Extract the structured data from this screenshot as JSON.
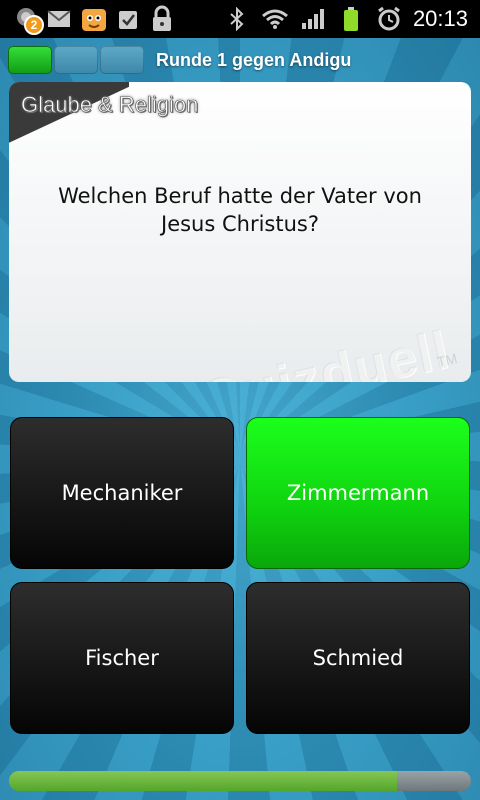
{
  "status_bar": {
    "notification_count": "2",
    "time": "20:13",
    "icons": [
      "notification-icon",
      "email-icon",
      "app-icon",
      "task-icon",
      "lock-icon",
      "bluetooth-icon",
      "wifi-icon",
      "signal-icon",
      "battery-icon",
      "alarm-icon"
    ]
  },
  "round": {
    "title": "Runde 1 gegen Andigu",
    "segments_done": 1,
    "segments_total": 3
  },
  "question": {
    "category": "Glaube & Religion",
    "text": "Welchen Beruf hatte der Vater von Jesus Christus?",
    "watermark": "Quizduell",
    "watermark_tm": "TM"
  },
  "answers": [
    {
      "label": "Mechaniker",
      "correct": false
    },
    {
      "label": "Zimmermann",
      "correct": true
    },
    {
      "label": "Fischer",
      "correct": false
    },
    {
      "label": "Schmied",
      "correct": false
    }
  ],
  "timer": {
    "fraction_remaining": 0.84
  },
  "colors": {
    "correct_green": "#0fd30f",
    "background_blue": "#2f8fb5",
    "answer_black": "#1a1a1a"
  }
}
